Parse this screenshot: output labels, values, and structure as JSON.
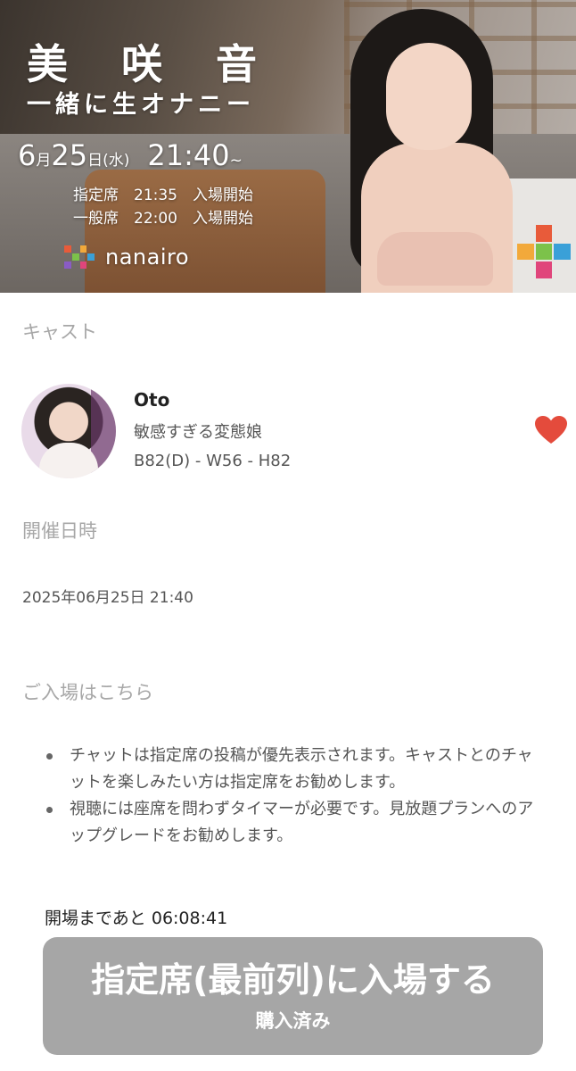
{
  "banner": {
    "title": "美 咲 音",
    "subtitle": "一緒に生オナニー",
    "date_month_day_1": "6",
    "date_month_unit": "月",
    "date_day": "25",
    "date_day_unit": "日",
    "date_weekday": "(水)",
    "date_time": "21:40",
    "date_time_suffix": "~",
    "seat_reserved": "指定席　21:35　入場開始",
    "seat_general": "一般席　22:00　入場開始",
    "brand_name": "nanairo",
    "brand_colors": [
      "#e85b3a",
      "#f2a93b",
      "#7cc24a",
      "#3aa0d8",
      "#8a5cc4",
      "#e0457b"
    ]
  },
  "cast_section": {
    "heading": "キャスト",
    "name": "Oto",
    "description": "敏感すぎる変態娘",
    "measurements": "B82(D) - W56 - H82",
    "favorite_icon": "heart-icon",
    "favorite_color": "#e44b3c"
  },
  "date_section": {
    "heading": "開催日時",
    "datetime": "2025年06月25日 21:40"
  },
  "entry_section": {
    "heading": "ご入場はこちら",
    "notes": [
      "チャットは指定席の投稿が優先表示されます。キャストとのチャットを楽しみたい方は指定席をお勧めします。",
      "視聴には座席を問わずタイマーが必要です。見放題プランへのアップグレードをお勧めします。"
    ],
    "countdown": "開場まであと 06:08:41",
    "button_label": "指定席(最前列)に入場する",
    "button_sublabel": "購入済み",
    "button_color": "#a6a6a6"
  }
}
